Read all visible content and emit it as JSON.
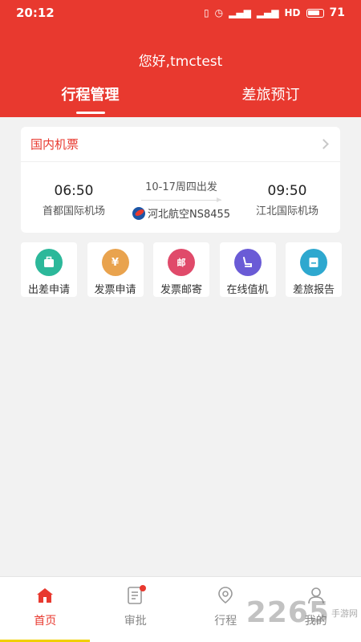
{
  "status_bar": {
    "time": "20:12",
    "battery": "71"
  },
  "header": {
    "greeting": "您好,tmctest"
  },
  "tabs": [
    {
      "label": "行程管理"
    },
    {
      "label": "差旅预订"
    }
  ],
  "trip_card": {
    "title": "国内机票",
    "departure_time": "06:50",
    "departure_airport": "首都国际机场",
    "date": "10-17周四出发",
    "airline": "河北航空NS8455",
    "arrival_time": "09:50",
    "arrival_airport": "江北国际机场"
  },
  "quick_actions": [
    {
      "label": "出差申请",
      "icon": "briefcase-icon",
      "color": "#2cb89a"
    },
    {
      "label": "发票申请",
      "icon": "yen-ticket-icon",
      "color": "#e9a34e",
      "glyph": "¥"
    },
    {
      "label": "发票邮寄",
      "icon": "mail-icon",
      "color": "#e04a6a",
      "glyph": "邮"
    },
    {
      "label": "在线值机",
      "icon": "seat-icon",
      "color": "#6a5bd6"
    },
    {
      "label": "差旅报告",
      "icon": "report-icon",
      "color": "#2ea8cf"
    }
  ],
  "bottom_nav": [
    {
      "label": "首页",
      "icon": "home-icon"
    },
    {
      "label": "审批",
      "icon": "approval-icon"
    },
    {
      "label": "行程",
      "icon": "location-icon"
    },
    {
      "label": "我的",
      "icon": "user-icon"
    }
  ],
  "watermark": {
    "number": "2265",
    "text": "手游网"
  },
  "colors": {
    "brand": "#e8392f"
  }
}
